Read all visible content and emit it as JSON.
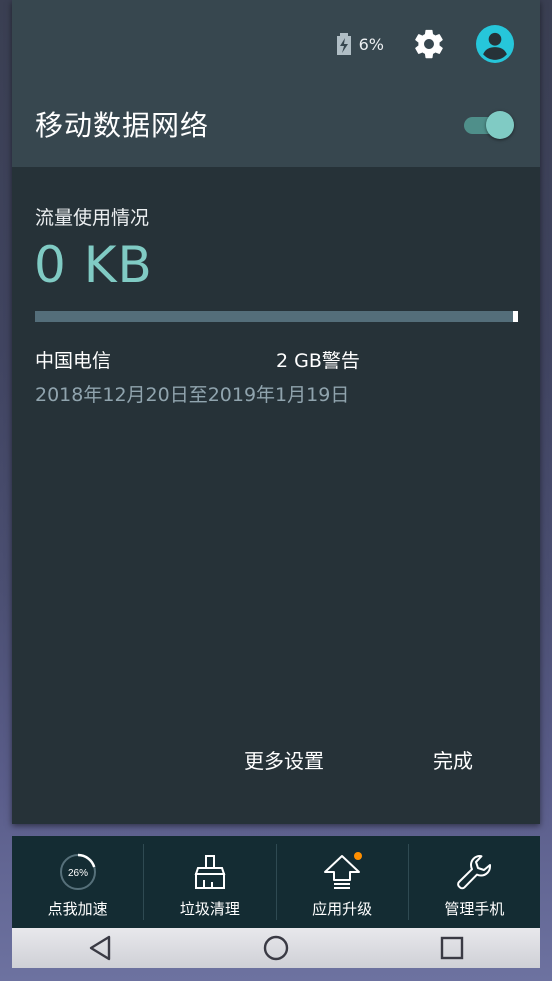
{
  "status": {
    "battery_percent": "6%"
  },
  "header": {
    "title": "移动数据网络",
    "toggle_on": true
  },
  "usage": {
    "label": "流量使用情况",
    "value": "0 KB",
    "fill_fraction": 0.0,
    "carrier": "中国电信",
    "warning": "2 GB警告",
    "date_range": "2018年12月20日至2019年1月19日"
  },
  "actions": {
    "more_settings": "更多设置",
    "done": "完成"
  },
  "dock": {
    "items": [
      {
        "label": "点我加速",
        "icon": "speedup-gauge-icon",
        "badge": "26%"
      },
      {
        "label": "垃圾清理",
        "icon": "broom-icon"
      },
      {
        "label": "应用升级",
        "icon": "upgrade-arrow-icon"
      },
      {
        "label": "管理手机",
        "icon": "wrench-icon"
      }
    ]
  },
  "colors": {
    "accent": "#80cbc4",
    "header_bg": "#37474f",
    "panel_bg": "#263238",
    "account_icon": "#26c6da",
    "upgrade_dot": "#ff8f00"
  }
}
